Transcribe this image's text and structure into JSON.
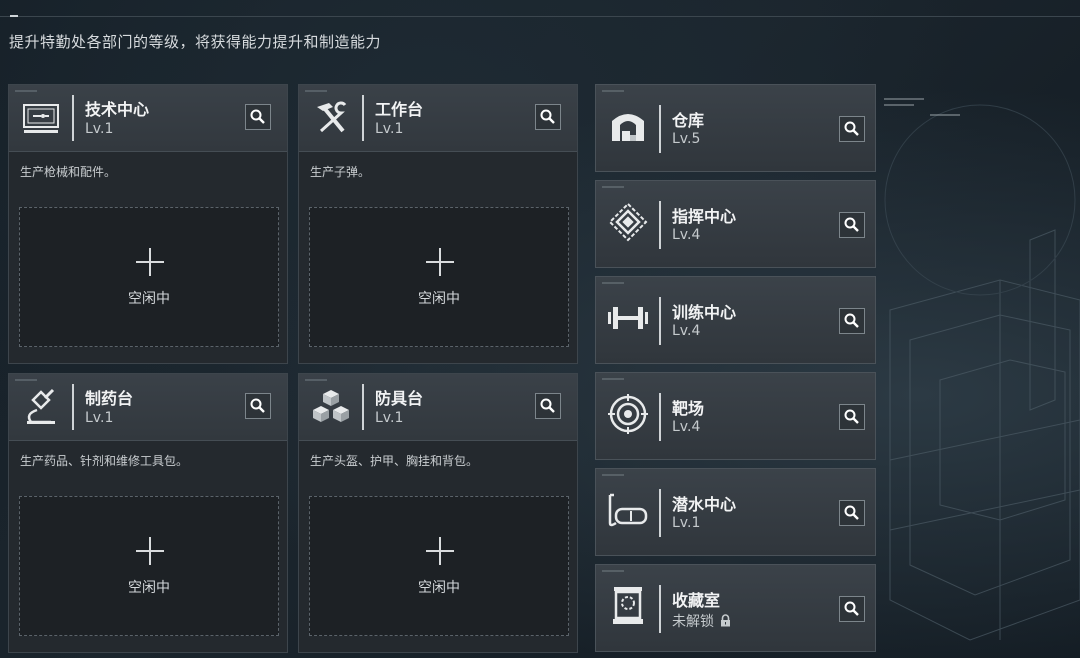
{
  "header": {
    "subtitle": "提升特勤处各部门的等级，将获得能力提升和制造能力"
  },
  "facilities": [
    {
      "name": "技术中心",
      "level": "Lv.1",
      "desc": "生产枪械和配件。",
      "slot": "空闲中",
      "icon": "computer-icon"
    },
    {
      "name": "工作台",
      "level": "Lv.1",
      "desc": "生产子弹。",
      "slot": "空闲中",
      "icon": "hammer-wrench-icon"
    },
    {
      "name": "制药台",
      "level": "Lv.1",
      "desc": "生产药品、针剂和维修工具包。",
      "slot": "空闲中",
      "icon": "microscope-icon"
    },
    {
      "name": "防具台",
      "level": "Lv.1",
      "desc": "生产头盔、护甲、胸挂和背包。",
      "slot": "空闲中",
      "icon": "cubes-icon"
    }
  ],
  "side_facilities": [
    {
      "name": "仓库",
      "level": "Lv.5",
      "icon": "warehouse-icon"
    },
    {
      "name": "指挥中心",
      "level": "Lv.4",
      "icon": "chip-icon"
    },
    {
      "name": "训练中心",
      "level": "Lv.4",
      "icon": "dumbbell-icon"
    },
    {
      "name": "靶场",
      "level": "Lv.4",
      "icon": "target-icon"
    },
    {
      "name": "潜水中心",
      "level": "Lv.1",
      "icon": "diving-mask-icon"
    },
    {
      "name": "收藏室",
      "level": "未解锁",
      "icon": "trophy-case-icon",
      "locked": true
    }
  ],
  "colors": {
    "accent": "#e6e8ea",
    "panel": "#24292e",
    "header": "#363d43"
  }
}
